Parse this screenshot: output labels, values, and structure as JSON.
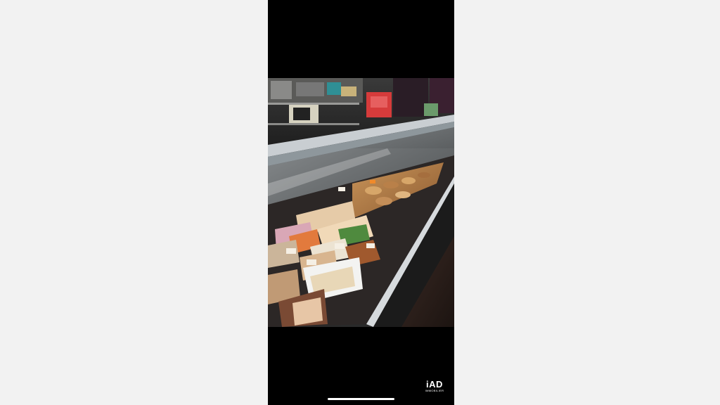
{
  "screen": {
    "background": "#f2f2f2",
    "frame_color": "#000000"
  },
  "photo": {
    "subject": "deli-counter-display-case"
  },
  "watermark": {
    "logo_text": "iAD",
    "sub_text": "IMMOBILIER",
    "color": "#ffffff"
  },
  "home_indicator": {
    "color": "#ffffff"
  }
}
